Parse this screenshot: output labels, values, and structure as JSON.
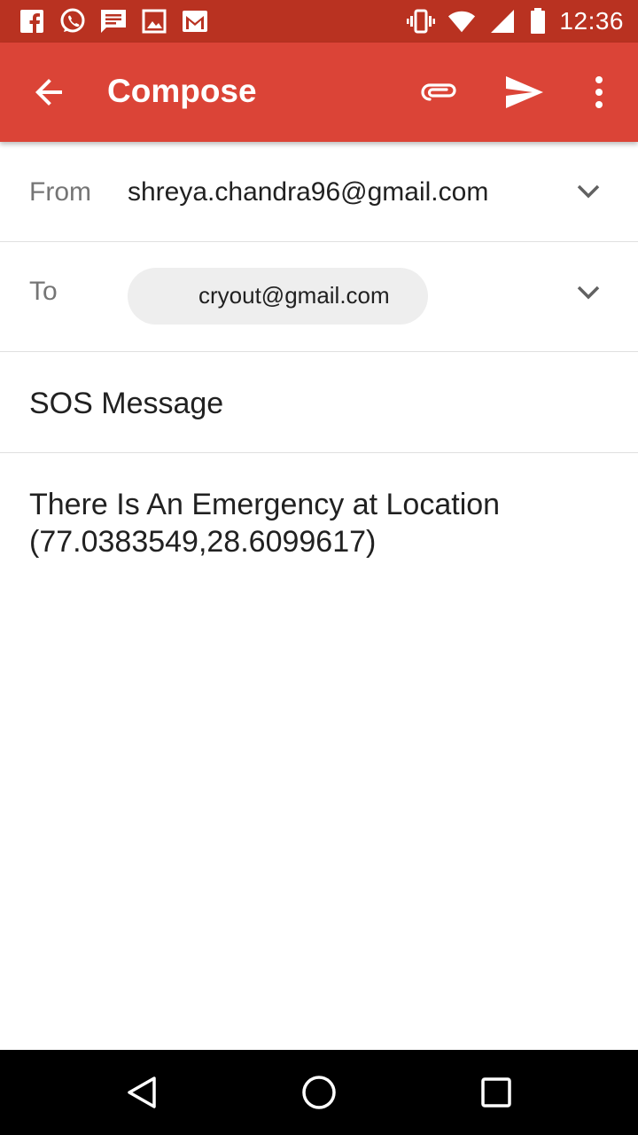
{
  "status_bar": {
    "time": "12:36",
    "left_icons": [
      "facebook-icon",
      "whatsapp-icon",
      "message-icon",
      "image-icon",
      "gmail-icon"
    ],
    "right_icons": [
      "vibrate-icon",
      "wifi-icon",
      "signal-icon",
      "battery-icon"
    ]
  },
  "app_bar": {
    "title": "Compose",
    "actions": [
      "attach-icon",
      "send-icon",
      "more-vert-icon"
    ]
  },
  "compose": {
    "from_label": "From",
    "from_value": "shreya.chandra96@gmail.com",
    "to_label": "To",
    "to_chip": "cryout@gmail.com",
    "subject": "SOS Message",
    "body": "There Is An Emergency at Location\n(77.0383549,28.6099617)"
  },
  "colors": {
    "status_bar": "#b93221",
    "app_bar": "#db4437",
    "nav_bar": "#000000"
  }
}
